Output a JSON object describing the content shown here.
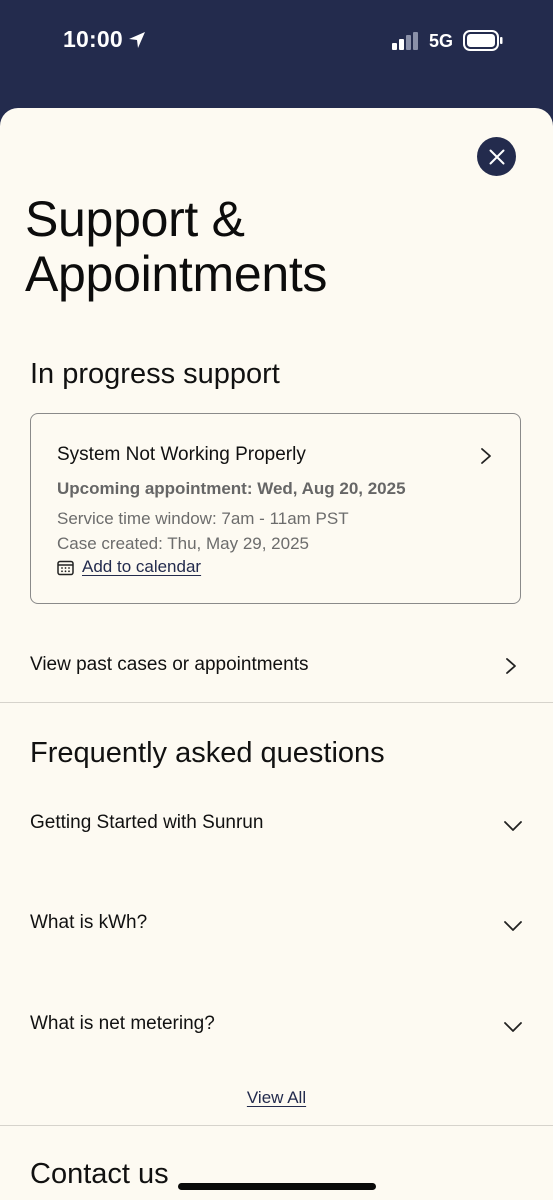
{
  "status_bar": {
    "time": "10:00",
    "network": "5G"
  },
  "page": {
    "title": "Support &\nAppointments"
  },
  "in_progress": {
    "heading": "In progress support",
    "case": {
      "title": "System Not Working Properly",
      "appointment": "Upcoming appointment: Wed, Aug 20, 2025",
      "service_window": "Service time window: 7am - 11am PST",
      "created": "Case created: Thu, May 29, 2025",
      "calendar_label": "Add to calendar"
    }
  },
  "past_cases": {
    "label": "View past cases or appointments"
  },
  "faq": {
    "heading": "Frequently asked questions",
    "items": [
      {
        "label": "Getting Started with Sunrun"
      },
      {
        "label": "What is kWh?"
      },
      {
        "label": "What is net metering?"
      }
    ],
    "view_all_label": "View All"
  },
  "contact": {
    "heading": "Contact us"
  },
  "colors": {
    "navy": "#232b4d",
    "sheet_background": "#fdfaf2",
    "muted_text": "#6c6c6c"
  }
}
